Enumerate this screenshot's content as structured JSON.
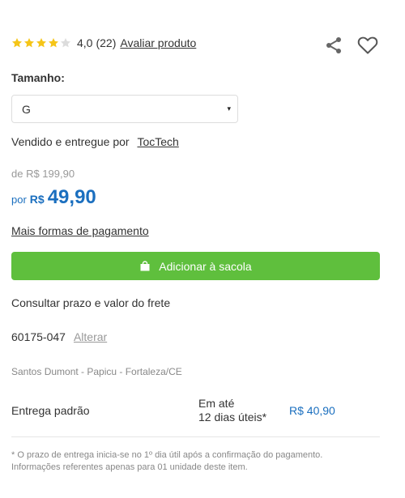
{
  "rating": {
    "stars_filled": 4,
    "stars_total": 5,
    "score": "4,0",
    "count": "(22)",
    "review_link": "Avaliar produto"
  },
  "icons": {
    "share": "share-icon",
    "favorite": "heart-icon",
    "bag": "bag-icon"
  },
  "size": {
    "label": "Tamanho:",
    "selected": "G",
    "caret": "▾"
  },
  "seller": {
    "prefix": "Vendido e entregue por",
    "name": "TocTech"
  },
  "price": {
    "old": "de R$ 199,90",
    "por": "por",
    "currency": "R$",
    "value": "49,90"
  },
  "payment_link": "Mais formas de pagamento",
  "cart_button": "Adicionar à sacola",
  "shipping": {
    "title": "Consultar prazo e valor do frete",
    "cep": "60175-047",
    "change_link": "Alterar",
    "address": "Santos Dumont - Papicu - Fortaleza/CE",
    "option_name": "Entrega padrão",
    "option_time_line1": "Em até",
    "option_time_line2": "12 dias úteis*",
    "option_price": "R$ 40,90"
  },
  "footnote": {
    "line1": "* O prazo de entrega inicia-se no 1º dia útil após a confirmação do pagamento.",
    "line2": "Informações referentes apenas para 01 unidade deste item."
  },
  "colors": {
    "star_filled": "#f5c518",
    "star_empty": "#dcdcdc",
    "price_blue": "#1b6fbf",
    "button_green": "#5fbf3d"
  }
}
